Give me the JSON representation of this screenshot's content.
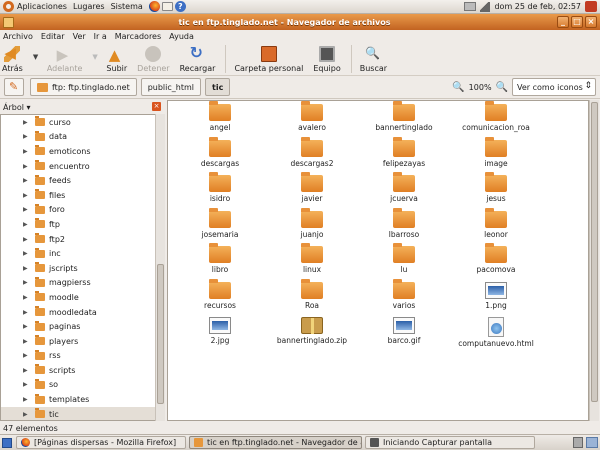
{
  "top_panel": {
    "menus": [
      "Aplicaciones",
      "Lugares",
      "Sistema"
    ],
    "clock": "dom 25 de feb, 02:57"
  },
  "window": {
    "title": "tic en ftp.tinglado.net - Navegador de archivos"
  },
  "menubar": [
    "Archivo",
    "Editar",
    "Ver",
    "Ir a",
    "Marcadores",
    "Ayuda"
  ],
  "toolbar": {
    "back": "Atrás",
    "forward": "Adelante",
    "up": "Subir",
    "stop": "Detener",
    "reload": "Recargar",
    "home": "Carpeta personal",
    "computer": "Equipo",
    "search": "Buscar"
  },
  "location": {
    "crumbs": [
      "ftp: ftp.tinglado.net",
      "public_html",
      "tic"
    ],
    "zoom": "100%",
    "view_mode": "Ver como iconos"
  },
  "sidebar": {
    "title": "Árbol",
    "items": [
      "curso",
      "data",
      "emoticons",
      "encuentro",
      "feeds",
      "files",
      "foro",
      "ftp",
      "ftp2",
      "inc",
      "jscripts",
      "magpierss",
      "moodle",
      "moodledata",
      "paginas",
      "players",
      "rss",
      "scripts",
      "so",
      "templates",
      "tic"
    ]
  },
  "files": [
    {
      "name": "angel",
      "type": "folder"
    },
    {
      "name": "avalero",
      "type": "folder"
    },
    {
      "name": "bannertinglado",
      "type": "folder"
    },
    {
      "name": "comunicacion_roa",
      "type": "folder"
    },
    {
      "name": "descargas",
      "type": "folder"
    },
    {
      "name": "descargas2",
      "type": "folder"
    },
    {
      "name": "felipezayas",
      "type": "folder"
    },
    {
      "name": "image",
      "type": "folder"
    },
    {
      "name": "isidro",
      "type": "folder"
    },
    {
      "name": "javier",
      "type": "folder"
    },
    {
      "name": "jcuerva",
      "type": "folder"
    },
    {
      "name": "jesus",
      "type": "folder"
    },
    {
      "name": "josemaria",
      "type": "folder"
    },
    {
      "name": "juanjo",
      "type": "folder"
    },
    {
      "name": "lbarroso",
      "type": "folder"
    },
    {
      "name": "leonor",
      "type": "folder"
    },
    {
      "name": "libro",
      "type": "folder"
    },
    {
      "name": "linux",
      "type": "folder"
    },
    {
      "name": "lu",
      "type": "folder"
    },
    {
      "name": "pacomova",
      "type": "folder"
    },
    {
      "name": "recursos",
      "type": "folder"
    },
    {
      "name": "Roa",
      "type": "folder"
    },
    {
      "name": "varios",
      "type": "folder"
    },
    {
      "name": "1.png",
      "type": "image"
    },
    {
      "name": "2.jpg",
      "type": "image"
    },
    {
      "name": "bannertinglado.zip",
      "type": "archive"
    },
    {
      "name": "barco.gif",
      "type": "image"
    },
    {
      "name": "computanuevo.html",
      "type": "html"
    }
  ],
  "status": "47 elementos",
  "taskbar": [
    {
      "label": "[Páginas dispersas - Mozilla Firefox]",
      "icon": "firefox",
      "active": false
    },
    {
      "label": "tic en ftp.tinglado.net - Navegador de a...",
      "icon": "folder",
      "active": true
    },
    {
      "label": "Iniciando Capturar pantalla",
      "icon": "camera",
      "active": false
    }
  ]
}
